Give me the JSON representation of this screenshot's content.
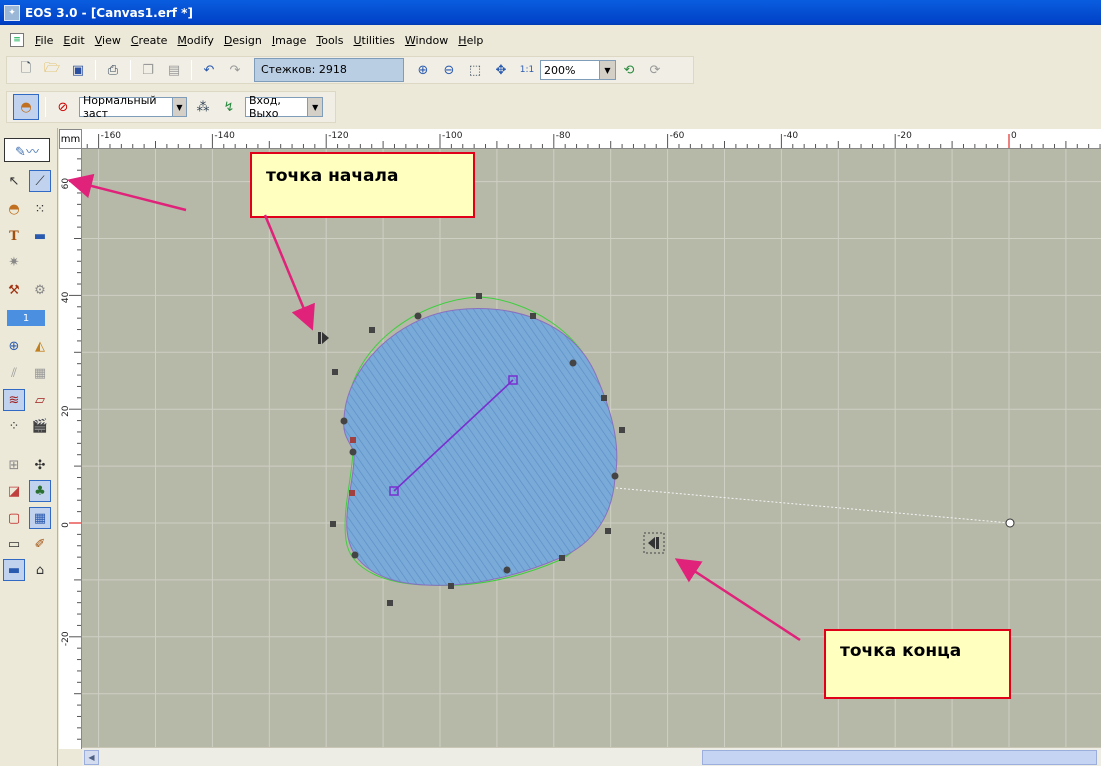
{
  "window": {
    "title": "EOS 3.0 - [Canvas1.erf *]",
    "app_icon": "app-icon"
  },
  "menu": [
    {
      "label": "File",
      "accel": "F"
    },
    {
      "label": "Edit",
      "accel": "E"
    },
    {
      "label": "View",
      "accel": "V"
    },
    {
      "label": "Create",
      "accel": "C"
    },
    {
      "label": "Modify",
      "accel": "M"
    },
    {
      "label": "Design",
      "accel": "D"
    },
    {
      "label": "Image",
      "accel": "I"
    },
    {
      "label": "Tools",
      "accel": "T"
    },
    {
      "label": "Utilities",
      "accel": "U"
    },
    {
      "label": "Window",
      "accel": "W"
    },
    {
      "label": "Help",
      "accel": "H"
    }
  ],
  "toolbar": {
    "stitch_count": "Стежков: 2918",
    "zoom": "200%",
    "fill_type": "Нормальный заст",
    "entry_exit": "Вход, Выхо"
  },
  "toolbox": {
    "color_number": "1"
  },
  "ruler": {
    "unit": "mm",
    "x_ticks": [
      "-160",
      "-140",
      "-120",
      "-100",
      "-80",
      "-60",
      "-40",
      "-20",
      "0"
    ],
    "y_ticks": [
      "60",
      "40",
      "20",
      "0",
      "-20"
    ]
  },
  "annotations": {
    "start_label": "точка начала",
    "end_label": "точка конца"
  },
  "colors": {
    "canvas_bg": "#b6b8a8",
    "grid": "#cfd0c4",
    "fill": "#6a9fd0",
    "arrow": "#e0227a",
    "callout_border": "#e0001a",
    "callout_bg": "#ffffc0"
  }
}
